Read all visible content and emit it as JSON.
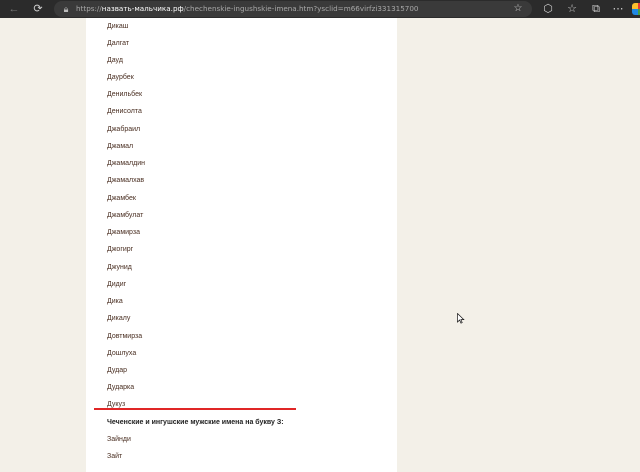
{
  "browser": {
    "url_scheme": "https://",
    "url_host": "назвать-мальчика.рф",
    "url_path": "/chechenskie-ingushskie-imena.htm?ysclid=m66virfzi331315700",
    "accent_color": "#e02626"
  },
  "content": {
    "names": [
      "Дикаш",
      "Далгат",
      "Дауд",
      "Даурбек",
      "Денильбек",
      "Денисолта",
      "Джабраил",
      "Джамал",
      "Джамалдин",
      "Джамалхав",
      "Джамбек",
      "Джамбулат",
      "Джамирза",
      "Джогирг",
      "Джунид",
      "Дидиг",
      "Дика",
      "Дикалу",
      "Довтмирза",
      "Дошлуха",
      "Дудар",
      "Дударка",
      "Дукуз"
    ],
    "section_heading": "Чеченские и ингушские мужские имена на букву З:",
    "next_names": [
      "Зайнди",
      "Зайт"
    ]
  }
}
